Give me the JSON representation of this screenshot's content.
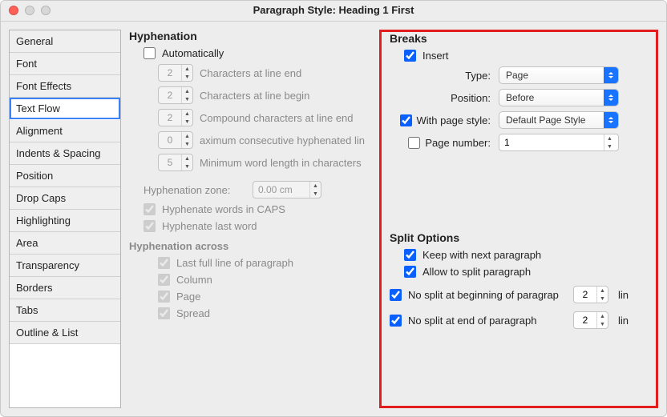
{
  "window": {
    "title": "Paragraph Style: Heading 1 First"
  },
  "sidebar": {
    "items": [
      {
        "label": "General"
      },
      {
        "label": "Font"
      },
      {
        "label": "Font Effects"
      },
      {
        "label": "Text Flow"
      },
      {
        "label": "Alignment"
      },
      {
        "label": "Indents & Spacing"
      },
      {
        "label": "Position"
      },
      {
        "label": "Drop Caps"
      },
      {
        "label": "Highlighting"
      },
      {
        "label": "Area"
      },
      {
        "label": "Transparency"
      },
      {
        "label": "Borders"
      },
      {
        "label": "Tabs"
      },
      {
        "label": "Outline & List"
      }
    ],
    "selected_index": 3
  },
  "hyphenation": {
    "title": "Hyphenation",
    "automatically_label": "Automatically",
    "automatically_checked": false,
    "chars_end_val": "2",
    "chars_end_label": "Characters at line end",
    "chars_begin_val": "2",
    "chars_begin_label": "Characters at line begin",
    "compound_val": "2",
    "compound_label": "Compound characters at line end",
    "max_consec_val": "0",
    "max_consec_label": "aximum consecutive hyphenated lin",
    "min_word_val": "5",
    "min_word_label": "Minimum word length in characters",
    "zone_label": "Hyphenation zone:",
    "zone_val": "0.00 cm",
    "caps_label": "Hyphenate words in CAPS",
    "lastword_label": "Hyphenate last word",
    "across_title": "Hyphenation across",
    "across_items": [
      "Last full line of paragraph",
      "Column",
      "Page",
      "Spread"
    ]
  },
  "breaks": {
    "title": "Breaks",
    "insert_label": "Insert",
    "insert_checked": true,
    "type_label": "Type:",
    "type_val": "Page",
    "position_label": "Position:",
    "position_val": "Before",
    "withstyle_label": "With page style:",
    "withstyle_checked": true,
    "withstyle_val": "Default Page Style",
    "pageno_label": "Page number:",
    "pageno_checked": false,
    "pageno_val": "1"
  },
  "split": {
    "title": "Split Options",
    "keep_label": "Keep with next paragraph",
    "keep_checked": true,
    "allow_label": "Allow to split paragraph",
    "allow_checked": true,
    "no_begin_label": "No split at beginning of paragrap",
    "no_begin_checked": true,
    "no_begin_val": "2",
    "no_begin_unit": "lin",
    "no_end_label": "No split at end of paragraph",
    "no_end_checked": true,
    "no_end_val": "2",
    "no_end_unit": "lin"
  }
}
